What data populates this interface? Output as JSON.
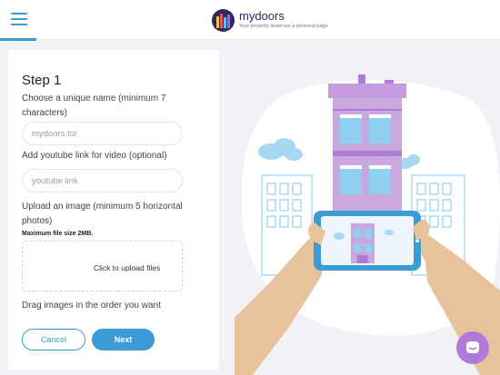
{
  "header": {
    "brand_name": "mydoors",
    "tagline": "Your property deserves a personal page",
    "menu_icon": "hamburger-menu-icon",
    "accent_color": "#3a9bd5"
  },
  "form": {
    "step_title": "Step 1",
    "name_label": "Choose a unique name (minimum 7 characters)",
    "name_placeholder": "mydoors.to/",
    "name_value": "",
    "youtube_label": "Add youtube link for video (optional)",
    "youtube_placeholder": "youtube link",
    "youtube_value": "",
    "upload_label": "Upload an image (minimum 5 horizontal photos)",
    "max_size_note": "Maximum file size 2MB.",
    "upload_prompt": "Click to upload files",
    "drag_hint": "Drag images in the order you want",
    "cancel_label": "Cancel",
    "next_label": "Next"
  },
  "chat": {
    "icon": "chat-bubble-icon",
    "color": "#b07bd6"
  },
  "illustration": {
    "icon": "phone-photographing-building-illustration"
  }
}
